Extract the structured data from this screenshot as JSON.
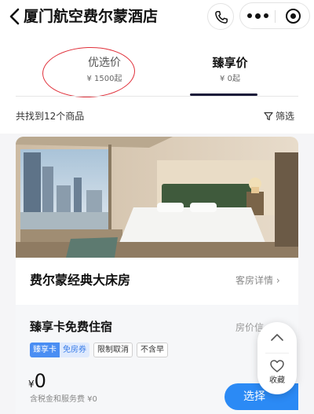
{
  "header": {
    "title": "厦门航空费尔蒙酒店",
    "back_icon": "chevron-left-icon",
    "phone_icon": "phone-icon",
    "more_icon": "more-dots-icon",
    "close_icon": "target-icon"
  },
  "tabs": [
    {
      "label": "优选价",
      "price": "¥ 1500起",
      "selected": false
    },
    {
      "label": "臻享价",
      "price": "¥ 0起",
      "selected": true
    }
  ],
  "results": {
    "count_text": "共找到12个商品",
    "filter_label": "筛选",
    "filter_icon": "filter-icon"
  },
  "room": {
    "name": "费尔蒙经典大床房",
    "detail_link": "客房详情",
    "photo": "hotel-room-photo"
  },
  "plan": {
    "title": "臻享卡免费住宿",
    "policy_text": "房价信",
    "tags": {
      "combo_primary": "臻享卡",
      "combo_secondary": "免房券",
      "items": [
        "限制取消",
        "不含早"
      ]
    },
    "price_currency": "¥",
    "price_value": "0",
    "tax_note": "含税金和服务费 ¥0",
    "select_label": "选择"
  },
  "float_panel": {
    "up_icon": "chevron-up-icon",
    "fav_icon": "heart-icon",
    "fav_label": "收藏"
  },
  "colors": {
    "accent_blue": "#2b8af5",
    "tab_underline": "#1a1a3a",
    "annotation_red": "#e0303a"
  }
}
